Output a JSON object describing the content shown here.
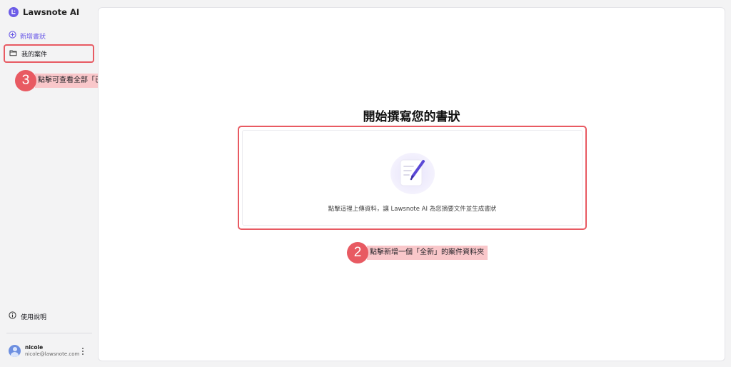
{
  "app": {
    "name": "Lawsnote AI",
    "logo_icon": "lawsnote-logo-icon"
  },
  "sidebar": {
    "new_case_label": "新增書狀",
    "my_cases_label": "我的案件",
    "help_label": "使用說明"
  },
  "user": {
    "name": "nicole",
    "email": "nicole@lawsnote.com"
  },
  "main": {
    "heading": "開始撰寫您的書狀",
    "upload_text": "點擊這裡上傳資料，讓 Lawsnote AI 為您摘要文件並生成書狀"
  },
  "annotations": [
    {
      "number": "3",
      "text": "點擊可查看全部「已建立」的案件資料夾"
    },
    {
      "number": "2",
      "text": "點擊新增一個「全新」的案件資料夾"
    }
  ],
  "colors": {
    "accent": "#6c5ce7",
    "highlight_red": "#e85a62",
    "callout_bg": "#f9c7ca",
    "sidebar_bg": "#f3f3f4"
  }
}
